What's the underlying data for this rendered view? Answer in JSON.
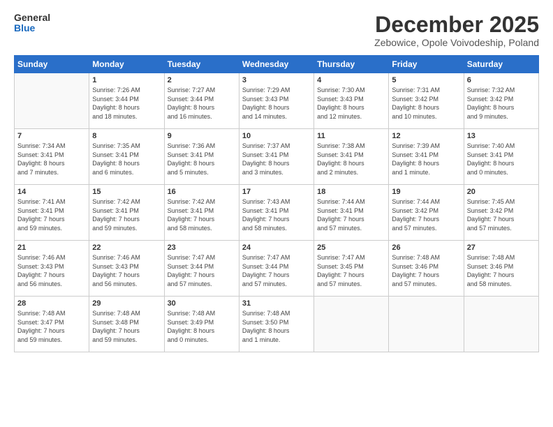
{
  "header": {
    "logo_line1": "General",
    "logo_line2": "Blue",
    "month": "December 2025",
    "location": "Zebowice, Opole Voivodeship, Poland"
  },
  "days_of_week": [
    "Sunday",
    "Monday",
    "Tuesday",
    "Wednesday",
    "Thursday",
    "Friday",
    "Saturday"
  ],
  "weeks": [
    [
      {
        "day": "",
        "info": ""
      },
      {
        "day": "1",
        "info": "Sunrise: 7:26 AM\nSunset: 3:44 PM\nDaylight: 8 hours\nand 18 minutes."
      },
      {
        "day": "2",
        "info": "Sunrise: 7:27 AM\nSunset: 3:44 PM\nDaylight: 8 hours\nand 16 minutes."
      },
      {
        "day": "3",
        "info": "Sunrise: 7:29 AM\nSunset: 3:43 PM\nDaylight: 8 hours\nand 14 minutes."
      },
      {
        "day": "4",
        "info": "Sunrise: 7:30 AM\nSunset: 3:43 PM\nDaylight: 8 hours\nand 12 minutes."
      },
      {
        "day": "5",
        "info": "Sunrise: 7:31 AM\nSunset: 3:42 PM\nDaylight: 8 hours\nand 10 minutes."
      },
      {
        "day": "6",
        "info": "Sunrise: 7:32 AM\nSunset: 3:42 PM\nDaylight: 8 hours\nand 9 minutes."
      }
    ],
    [
      {
        "day": "7",
        "info": "Sunrise: 7:34 AM\nSunset: 3:41 PM\nDaylight: 8 hours\nand 7 minutes."
      },
      {
        "day": "8",
        "info": "Sunrise: 7:35 AM\nSunset: 3:41 PM\nDaylight: 8 hours\nand 6 minutes."
      },
      {
        "day": "9",
        "info": "Sunrise: 7:36 AM\nSunset: 3:41 PM\nDaylight: 8 hours\nand 5 minutes."
      },
      {
        "day": "10",
        "info": "Sunrise: 7:37 AM\nSunset: 3:41 PM\nDaylight: 8 hours\nand 3 minutes."
      },
      {
        "day": "11",
        "info": "Sunrise: 7:38 AM\nSunset: 3:41 PM\nDaylight: 8 hours\nand 2 minutes."
      },
      {
        "day": "12",
        "info": "Sunrise: 7:39 AM\nSunset: 3:41 PM\nDaylight: 8 hours\nand 1 minute."
      },
      {
        "day": "13",
        "info": "Sunrise: 7:40 AM\nSunset: 3:41 PM\nDaylight: 8 hours\nand 0 minutes."
      }
    ],
    [
      {
        "day": "14",
        "info": "Sunrise: 7:41 AM\nSunset: 3:41 PM\nDaylight: 7 hours\nand 59 minutes."
      },
      {
        "day": "15",
        "info": "Sunrise: 7:42 AM\nSunset: 3:41 PM\nDaylight: 7 hours\nand 59 minutes."
      },
      {
        "day": "16",
        "info": "Sunrise: 7:42 AM\nSunset: 3:41 PM\nDaylight: 7 hours\nand 58 minutes."
      },
      {
        "day": "17",
        "info": "Sunrise: 7:43 AM\nSunset: 3:41 PM\nDaylight: 7 hours\nand 58 minutes."
      },
      {
        "day": "18",
        "info": "Sunrise: 7:44 AM\nSunset: 3:41 PM\nDaylight: 7 hours\nand 57 minutes."
      },
      {
        "day": "19",
        "info": "Sunrise: 7:44 AM\nSunset: 3:42 PM\nDaylight: 7 hours\nand 57 minutes."
      },
      {
        "day": "20",
        "info": "Sunrise: 7:45 AM\nSunset: 3:42 PM\nDaylight: 7 hours\nand 57 minutes."
      }
    ],
    [
      {
        "day": "21",
        "info": "Sunrise: 7:46 AM\nSunset: 3:43 PM\nDaylight: 7 hours\nand 56 minutes."
      },
      {
        "day": "22",
        "info": "Sunrise: 7:46 AM\nSunset: 3:43 PM\nDaylight: 7 hours\nand 56 minutes."
      },
      {
        "day": "23",
        "info": "Sunrise: 7:47 AM\nSunset: 3:44 PM\nDaylight: 7 hours\nand 57 minutes."
      },
      {
        "day": "24",
        "info": "Sunrise: 7:47 AM\nSunset: 3:44 PM\nDaylight: 7 hours\nand 57 minutes."
      },
      {
        "day": "25",
        "info": "Sunrise: 7:47 AM\nSunset: 3:45 PM\nDaylight: 7 hours\nand 57 minutes."
      },
      {
        "day": "26",
        "info": "Sunrise: 7:48 AM\nSunset: 3:46 PM\nDaylight: 7 hours\nand 57 minutes."
      },
      {
        "day": "27",
        "info": "Sunrise: 7:48 AM\nSunset: 3:46 PM\nDaylight: 7 hours\nand 58 minutes."
      }
    ],
    [
      {
        "day": "28",
        "info": "Sunrise: 7:48 AM\nSunset: 3:47 PM\nDaylight: 7 hours\nand 59 minutes."
      },
      {
        "day": "29",
        "info": "Sunrise: 7:48 AM\nSunset: 3:48 PM\nDaylight: 7 hours\nand 59 minutes."
      },
      {
        "day": "30",
        "info": "Sunrise: 7:48 AM\nSunset: 3:49 PM\nDaylight: 8 hours\nand 0 minutes."
      },
      {
        "day": "31",
        "info": "Sunrise: 7:48 AM\nSunset: 3:50 PM\nDaylight: 8 hours\nand 1 minute."
      },
      {
        "day": "",
        "info": ""
      },
      {
        "day": "",
        "info": ""
      },
      {
        "day": "",
        "info": ""
      }
    ]
  ]
}
